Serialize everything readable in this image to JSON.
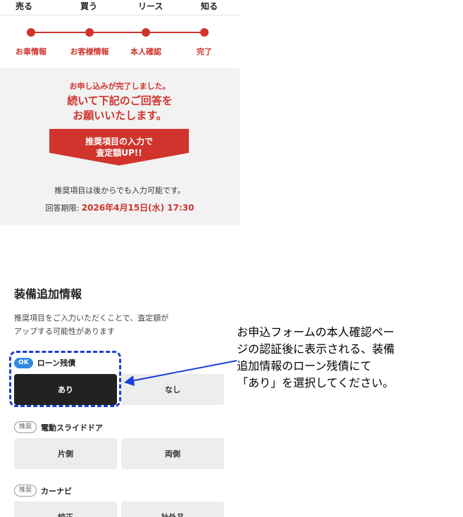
{
  "nav": {
    "items": [
      "売る",
      "買う",
      "リース",
      "知る"
    ]
  },
  "stepper": {
    "steps": [
      "お車情報",
      "お客様情報",
      "本人確認",
      "完了"
    ]
  },
  "completion": {
    "message_small": "お申し込みが完了しました。",
    "message_line1": "続いて下記のご回答を",
    "message_line2": "お願いいたします。",
    "arrow_line1": "推奨項目の入力で",
    "arrow_line2": "査定額UP!!",
    "note": "推奨項目は後からでも入力可能です。",
    "deadline_label": "回答期限: ",
    "deadline_value": "2026年4月15日(水) 17:30"
  },
  "equipment": {
    "title": "装備追加情報",
    "desc_line1": "推奨項目をご入力いただくことで、査定額が",
    "desc_line2": "アップする可能性があります",
    "questions": [
      {
        "badge": "OK",
        "label": "ローン残債",
        "options": [
          "あり",
          "なし"
        ],
        "selected": 0
      },
      {
        "badge": "推奨",
        "label": "電動スライドドア",
        "options": [
          "片側",
          "両側"
        ],
        "selected": null
      },
      {
        "badge": "推奨",
        "label": "カーナビ",
        "options": [
          "純正",
          "社外品"
        ],
        "selected": null
      }
    ]
  },
  "annotation": {
    "line1": "お申込フォームの本人確認ペー",
    "line2": "ジの認証後に表示される、装備",
    "line3": "追加情報のローン残債にて",
    "line4": "「あり」を選択してください。"
  },
  "colors": {
    "accent_red": "#d0342c",
    "annotation_blue": "#1a3fd6",
    "ok_badge_blue": "#2f8ae0",
    "selected_dark": "#222222"
  }
}
